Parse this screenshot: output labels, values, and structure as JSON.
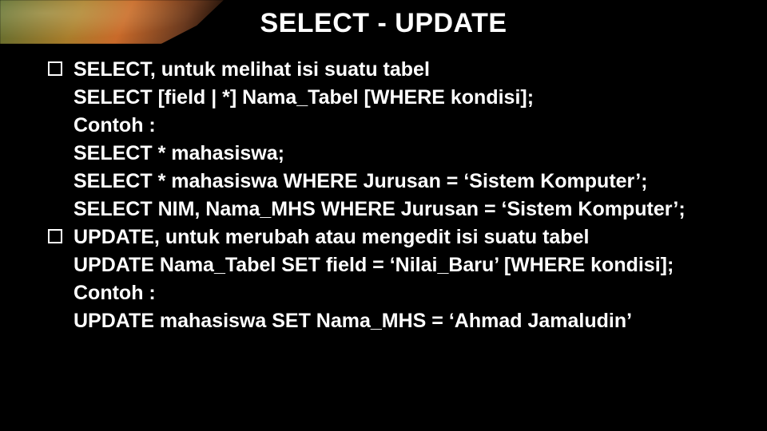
{
  "title": "SELECT - UPDATE",
  "bullets": [
    {
      "head": "SELECT, untuk melihat isi suatu tabel",
      "lines": [
        "SELECT [field | *] Nama_Tabel [WHERE kondisi];",
        "Contoh :",
        "SELECT * mahasiswa;",
        "SELECT * mahasiswa WHERE Jurusan = ‘Sistem Komputer’;",
        "SELECT NIM, Nama_MHS WHERE Jurusan = ‘Sistem Komputer’;"
      ]
    },
    {
      "head": "UPDATE, untuk merubah atau mengedit isi suatu tabel",
      "lines": [
        "UPDATE Nama_Tabel SET field = ‘Nilai_Baru’ [WHERE kondisi];",
        "Contoh :",
        "UPDATE mahasiswa SET Nama_MHS = ‘Ahmad Jamaludin’"
      ]
    }
  ]
}
